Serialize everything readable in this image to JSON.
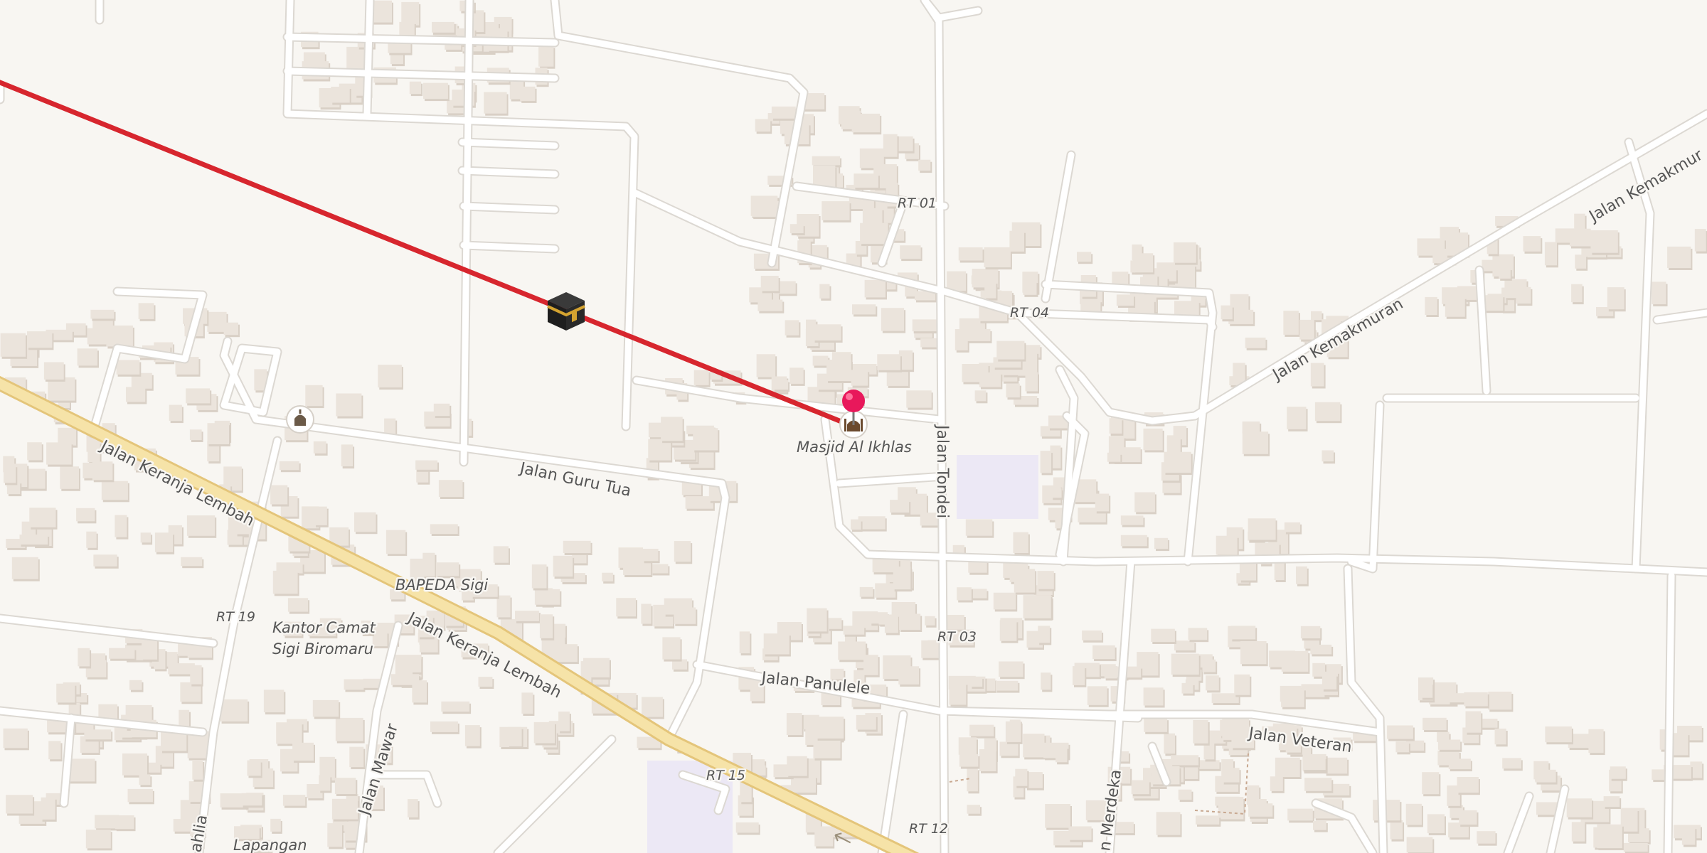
{
  "map": {
    "colors": {
      "land": "#f8f6f2",
      "road": "#ffffff",
      "road_casing": "#dcd8d2",
      "primary": "#f6e3a8",
      "primary_casing": "#e4c57a",
      "building": "#ebe4dc",
      "building_shadow": "#d9d0c6",
      "qibla_line": "#d7262e",
      "pin": "#e8185b",
      "landuse": "#ece8f5"
    },
    "street_labels": {
      "keranja_lembah_1": "Jalan Keranja Lembah",
      "keranja_lembah_2": "Jalan Keranja Lembah",
      "guru_tua": "Jalan Guru Tua",
      "tondei": "Jalan Tondei",
      "kemakmuran_1": "Jalan Kemakmuran",
      "kemakmuran_2": "Jalan Kemakmur",
      "panulele": "Jalan Panulele",
      "veteran": "Jalan Veteran",
      "mawar": "Jalan Mawar",
      "merdeka": "n Merdeka",
      "dahlia": "ahlia"
    },
    "place_labels": {
      "rt01": "RT 01",
      "rt04": "RT 04",
      "rt03": "RT 03",
      "rt19": "RT 19",
      "rt15": "RT 15",
      "rt12": "RT 12"
    },
    "poi_labels": {
      "mosque": "Masjid Al Ikhlas",
      "bapeda": "BAPEDA Sigi",
      "kantor_1": "Kantor Camat",
      "kantor_2": "Sigi Biromaru",
      "lapangan": "Lapangan"
    },
    "icons": {
      "kaaba": "kaaba-icon",
      "pin": "location-pin-icon",
      "mosque": "mosque-icon",
      "place_of_worship": "place-of-worship-icon",
      "oneway": "oneway-arrow-icon"
    }
  }
}
